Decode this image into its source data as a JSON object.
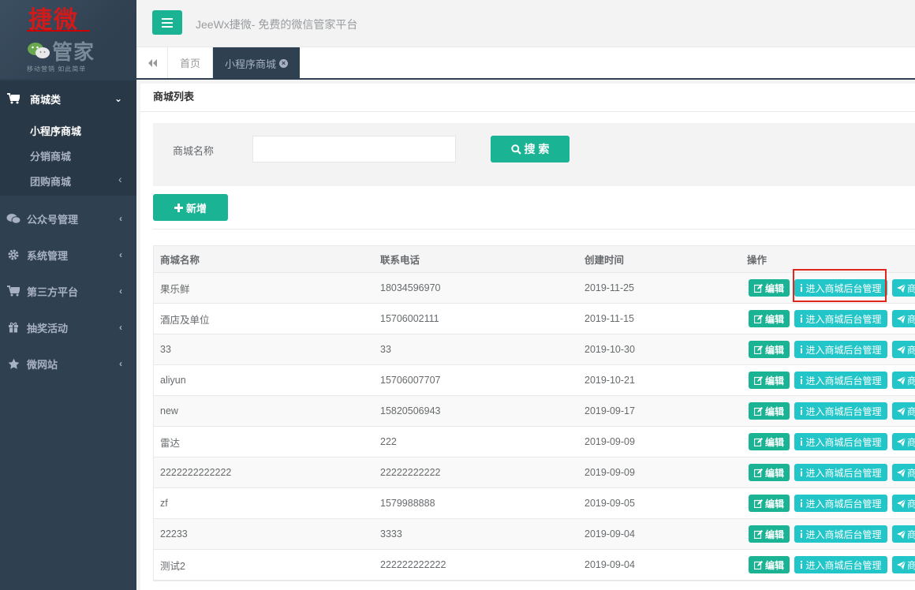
{
  "logo": {
    "brand_top": "捷微",
    "brand_sub": "管家",
    "tagline": "移动营销 如此简单"
  },
  "sidebar": {
    "active_group": {
      "label": "商城类",
      "icon": "cart-icon",
      "sub_items": [
        {
          "label": "小程序商城"
        },
        {
          "label": "分销商城"
        },
        {
          "label": "团购商城"
        }
      ]
    },
    "items": [
      {
        "label": "公众号管理",
        "icon": "wechat-icon"
      },
      {
        "label": "系统管理",
        "icon": "gear-icon"
      },
      {
        "label": "第三方平台",
        "icon": "cart-icon"
      },
      {
        "label": "抽奖活动",
        "icon": "gift-icon"
      },
      {
        "label": "微网站",
        "icon": "star-icon"
      }
    ]
  },
  "header": {
    "title": "JeeWx捷微- 免费的微信管家平台"
  },
  "tabs": [
    {
      "label": "首页"
    },
    {
      "label": "小程序商城"
    }
  ],
  "panel": {
    "title": "商城列表"
  },
  "search": {
    "label": "商城名称",
    "value": "",
    "button": "搜 索"
  },
  "toolbar": {
    "add_label": "新增"
  },
  "table": {
    "headers": [
      "商城名称",
      "联系电话",
      "创建时间",
      "操作"
    ],
    "actions": {
      "edit": "编辑",
      "enter": "进入商城后台管理",
      "more": "商"
    },
    "rows": [
      {
        "name": "果乐鲜",
        "phone": "18034596970",
        "date": "2019-11-25"
      },
      {
        "name": "酒店及单位",
        "phone": "15706002111",
        "date": "2019-11-15"
      },
      {
        "name": "33",
        "phone": "33",
        "date": "2019-10-30"
      },
      {
        "name": "aliyun",
        "phone": "15706007707",
        "date": "2019-10-21"
      },
      {
        "name": "new",
        "phone": "15820506943",
        "date": "2019-09-17"
      },
      {
        "name": "雷达",
        "phone": "222",
        "date": "2019-09-09"
      },
      {
        "name": "2222222222222",
        "phone": "22222222222",
        "date": "2019-09-09"
      },
      {
        "name": "zf",
        "phone": "1579988888",
        "date": "2019-09-05"
      },
      {
        "name": "22233",
        "phone": "3333",
        "date": "2019-09-04"
      },
      {
        "name": "测试2",
        "phone": "222222222222",
        "date": "2019-09-04"
      }
    ]
  },
  "colors": {
    "sidebar": "#2f4050",
    "primary": "#1ab394",
    "info": "#23c6c8",
    "highlight": "#e0261d"
  }
}
